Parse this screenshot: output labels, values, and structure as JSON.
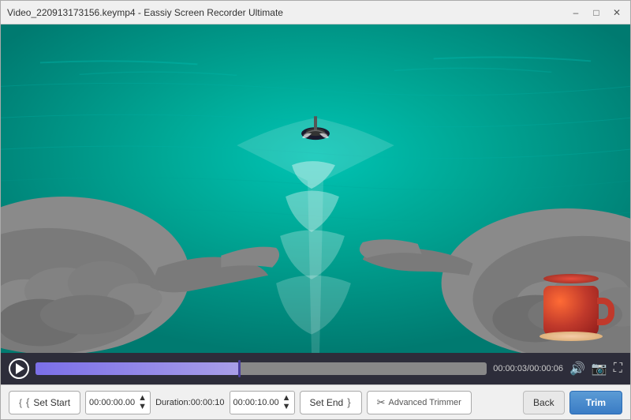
{
  "window": {
    "title": "Video_220913173156.keymp4  -  Eassiy Screen Recorder Ultimate"
  },
  "titlebar": {
    "minimize_label": "–",
    "maximize_label": "□",
    "close_label": "✕"
  },
  "controls": {
    "time_current": "00:00:03",
    "time_total": "00:00:06",
    "start_time_value": "00:00:00.00",
    "duration_label": "Duration:00:00:10",
    "end_time_value": "00:00:10.00"
  },
  "toolbar": {
    "set_start_label": "Set Start",
    "set_end_label": "Set End }",
    "advanced_label": "Advanced Trimmer",
    "back_label": "Back",
    "trim_label": "Trim"
  }
}
